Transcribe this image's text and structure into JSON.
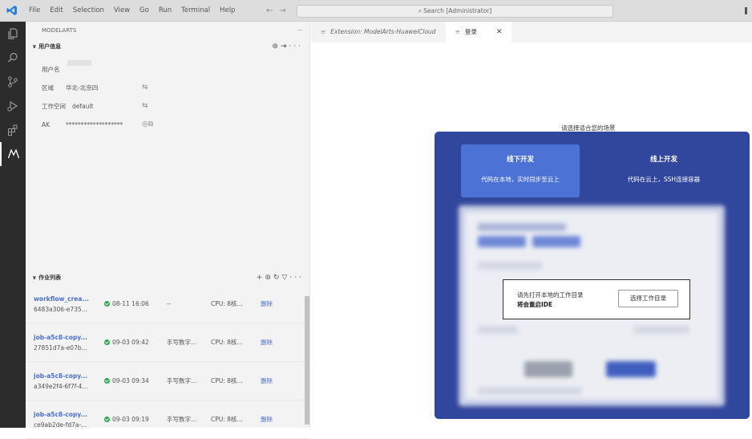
{
  "menu": [
    "File",
    "Edit",
    "Selection",
    "View",
    "Go",
    "Run",
    "Terminal",
    "Help"
  ],
  "search": {
    "text": "Search [Administrator]"
  },
  "activity_icons": [
    "explorer-icon",
    "search-icon",
    "source-control-icon",
    "run-debug-icon",
    "extensions-icon",
    "modelarts-icon"
  ],
  "sidebar": {
    "title": "MODELARTS",
    "more": "···",
    "user_section": {
      "title": "用户信息",
      "rows": [
        {
          "key": "用户名",
          "value": ""
        },
        {
          "key": "区域",
          "value": "华北-北京四"
        },
        {
          "key": "工作空间",
          "value": "default"
        },
        {
          "key": "AK",
          "value": "*******************"
        }
      ]
    },
    "jobs_section": {
      "title": "作业列表",
      "jobs": [
        {
          "name": "workflow_crea...",
          "id": "6483a306-e735...",
          "time": "08-11 16:06",
          "dataset": "--",
          "spec": "CPU: 8核...",
          "action": "删除"
        },
        {
          "name": "job-a5c8-copy...",
          "id": "27851d7a-e07b...",
          "time": "09-03 09:42",
          "dataset": "手写数字...",
          "spec": "CPU: 8核...",
          "action": "删除"
        },
        {
          "name": "job-a5c8-copy...",
          "id": "a349e2f4-6f7f-4...",
          "time": "09-03 09:34",
          "dataset": "手写数字...",
          "spec": "CPU: 8核...",
          "action": "删除"
        },
        {
          "name": "job-a5c8-copy...",
          "id": "ce9ab2de-fd7a-...",
          "time": "09-03 09:19",
          "dataset": "手写数字...",
          "spec": "CPU: 8核...",
          "action": "删除"
        }
      ]
    }
  },
  "tabs": [
    {
      "label": "Extension: ModelArts-HuaweiCloud"
    },
    {
      "label": "登录"
    }
  ],
  "editor": {
    "prompt": "请选择适合您的场景",
    "option_offline": {
      "title": "线下开发",
      "desc": "代码在本地，实时同步至云上"
    },
    "option_online": {
      "title": "线上开发",
      "desc": "代码在云上，SSH连接容器"
    },
    "dialog": {
      "line1": "请先打开本地的工作目录",
      "line2": "将会重启IDE",
      "button": "选择工作目录"
    }
  },
  "colors": {
    "accent": "#31469d",
    "selected": "#4c72d6",
    "link": "#4b6fd4",
    "success": "#29a84a"
  }
}
